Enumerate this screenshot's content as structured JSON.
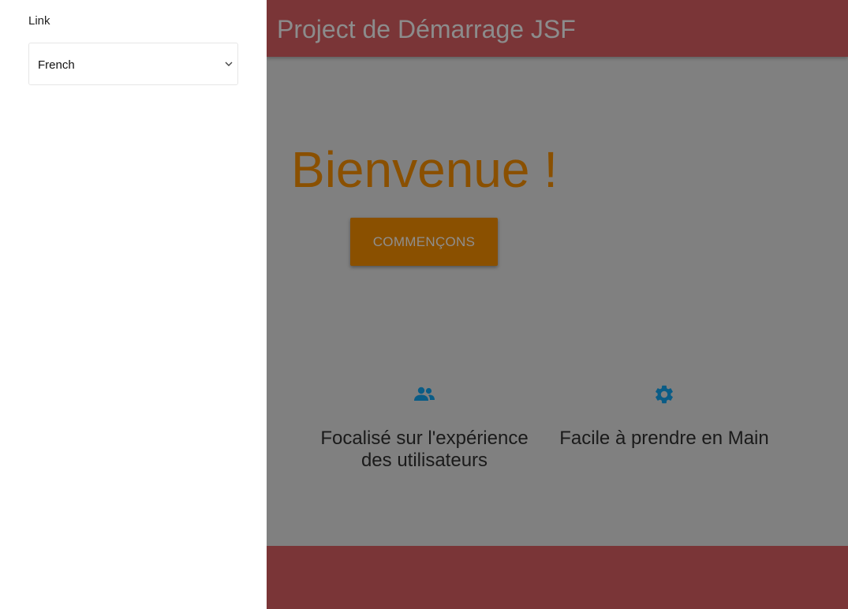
{
  "sidebar": {
    "label": "Link",
    "language_select": {
      "value": "French"
    }
  },
  "header": {
    "title": "Project de Démarrage JSF"
  },
  "hero": {
    "title": "Bienvenue !",
    "cta_label": "COMMENÇONS"
  },
  "features": [
    {
      "icon": "people-icon",
      "text": "Focalisé sur l'expérience des utilisateurs"
    },
    {
      "icon": "gear-icon",
      "text": "Facile à prendre en Main"
    }
  ],
  "colors": {
    "header_bg": "#7a3537",
    "overlay": "#808080",
    "accent": "#8a5000",
    "icon": "#0a5c86"
  }
}
